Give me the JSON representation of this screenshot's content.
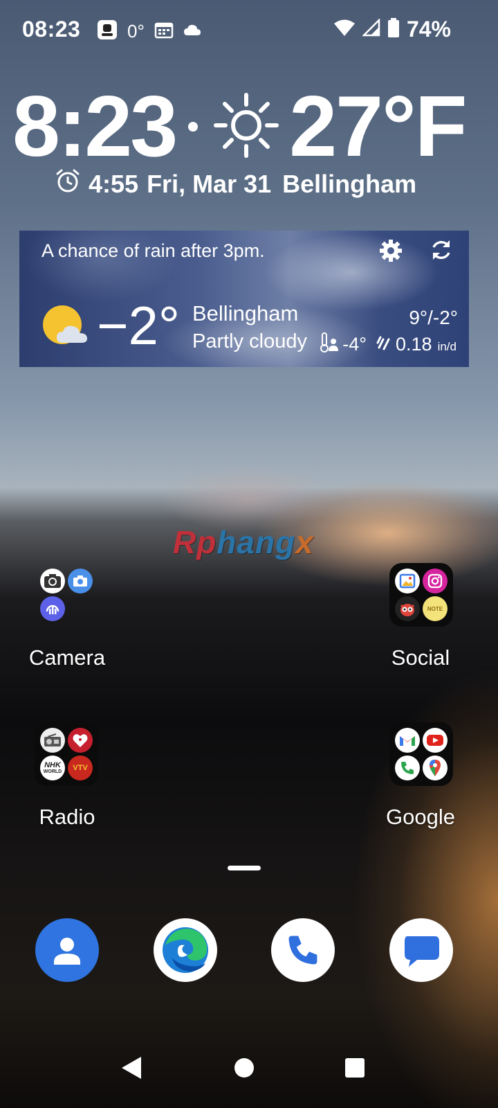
{
  "status_bar": {
    "time": "08:23",
    "temp": "0°",
    "battery": "74%"
  },
  "clock_widget": {
    "time": "8:23",
    "temperature": "27°F",
    "alarm": "4:55",
    "date": "Fri, Mar 31",
    "location": "Bellingham"
  },
  "weather_widget": {
    "forecast": "A chance of rain after 3pm.",
    "current_temp": "−2°",
    "city": "Bellingham",
    "condition": "Partly cloudy",
    "hi_lo": "9°/-2°",
    "feels_like": "-4°",
    "precip": "0.18",
    "precip_unit": "in/d"
  },
  "watermark": {
    "part1": "Rp",
    "part2": "hang",
    "part3": "x"
  },
  "folders": [
    {
      "label": "Camera"
    },
    {
      "label": "Social"
    },
    {
      "label": "Radio"
    },
    {
      "label": "Google"
    }
  ],
  "radio_icons": {
    "nhk_line1": "NHK",
    "nhk_line2": "WORLD",
    "vtv": "VTV"
  },
  "social_icons": {
    "note": "NOTE"
  },
  "colors": {
    "accent_blue": "#2f6fde",
    "contacts_blue": "#2f74e0",
    "youtube_red": "#e0241b",
    "instagram_pink": "#d6249f"
  }
}
